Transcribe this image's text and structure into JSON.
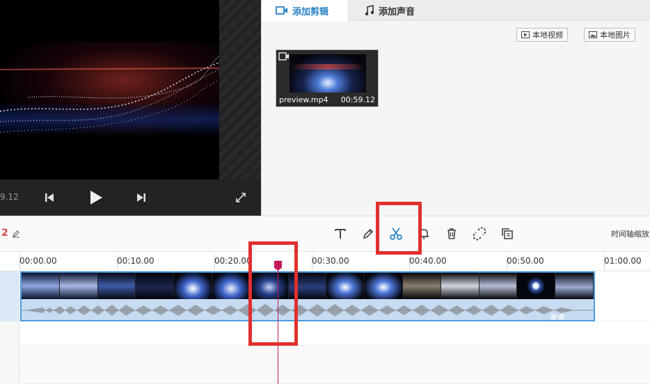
{
  "preview": {
    "time_display": "9.12"
  },
  "library": {
    "tabs": [
      {
        "label": "添加剪辑",
        "icon": "video-camera-icon"
      },
      {
        "label": "添加声音",
        "icon": "music-note-icon"
      }
    ],
    "buttons": {
      "local_video": "本地视频",
      "local_image": "本地图片"
    },
    "clip": {
      "name": "preview.mp4",
      "duration": "00:59.12"
    }
  },
  "toolbar": {
    "track_count": "2",
    "tools": [
      "text-icon",
      "pencil-icon",
      "scissors-icon",
      "bell-icon",
      "trash-icon",
      "unlink-icon",
      "copy-icon"
    ],
    "zoom_label": "时间轴缩放"
  },
  "timeline": {
    "ticks": [
      "00:00.00",
      "00:10.00",
      "00:20.00",
      "00:30.00",
      "00:40.00",
      "00:50.00",
      "01:00.00"
    ],
    "playhead_time_seconds": 26.5
  },
  "colors": {
    "accent": "#2a83c8",
    "highlight": "#e0302e",
    "playhead": "#c2185b",
    "clip_border": "#4a9be0"
  }
}
